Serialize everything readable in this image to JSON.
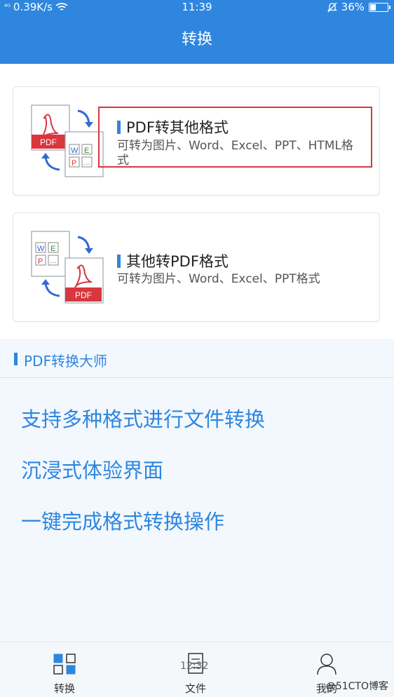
{
  "status_bar": {
    "signal": "⁴ᴳ",
    "speed": "0.39K/s",
    "time": "11:39",
    "battery_pct": "36%",
    "battery_level": 0.36
  },
  "title": "转换",
  "cards": [
    {
      "title": "PDF转其他格式",
      "desc": "可转为图片、Word、Excel、PPT、HTML格式",
      "doc_label": "PDF"
    },
    {
      "title": "其他转PDF格式",
      "desc": "可转为图片、Word、Excel、PPT格式",
      "doc_label": "PDF"
    }
  ],
  "office_tiles": [
    "W",
    "E",
    "P",
    "…"
  ],
  "info": {
    "heading": "PDF转换大师",
    "features": [
      "支持多种格式进行文件转换",
      "沉浸式体验界面",
      "一键完成格式转换操作"
    ]
  },
  "tabs": [
    {
      "label": "转换",
      "icon": "convert-icon"
    },
    {
      "label": "文件",
      "icon": "file-icon"
    },
    {
      "label": "我的",
      "icon": "user-icon"
    }
  ],
  "overlay_number": "12:32",
  "watermark": "@51CTO博客",
  "colors": {
    "primary": "#2f86de",
    "highlight": "#d9363e",
    "pdf_red": "#d9363e"
  }
}
